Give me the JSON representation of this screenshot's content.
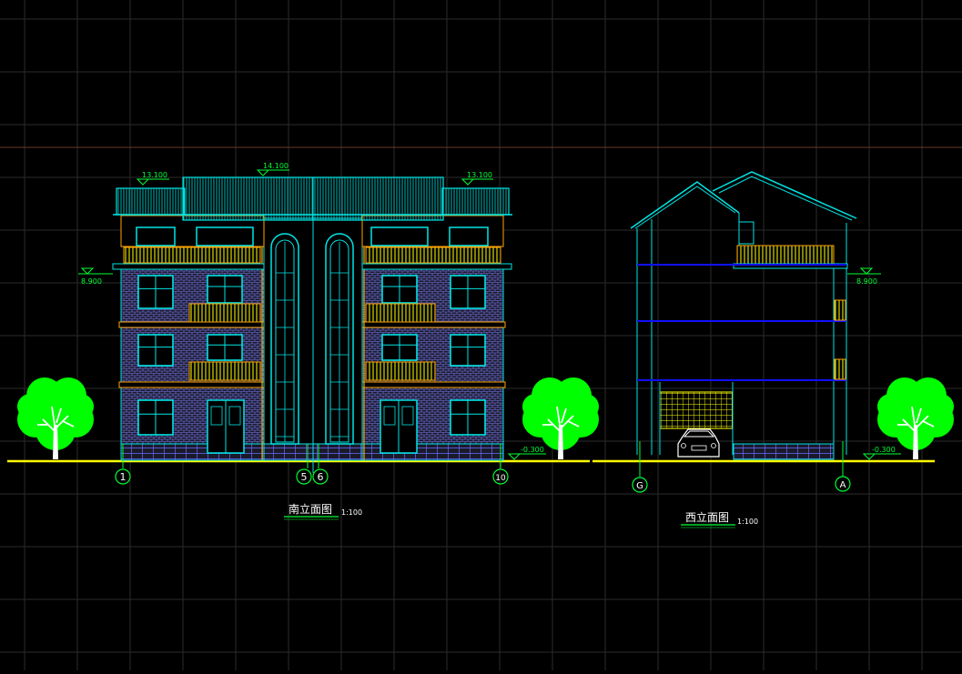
{
  "canvas": {
    "background": "#000000",
    "grid_color": "#2b2b2b",
    "crosshair_color": "#6a3a2a"
  },
  "colors": {
    "outline": "#00e5e5",
    "level": "#00ff33",
    "yellow": "#ffff00",
    "orange": "#ffa500",
    "blue": "#1010ff",
    "white": "#ffffff",
    "tree": "#00ff00",
    "brick": "#8080ff"
  },
  "south": {
    "title": "南立面图",
    "scale": "1:100",
    "levels": {
      "roof_left": "13.100",
      "roof_mid": "14.100",
      "roof_right": "13.100",
      "floor3": "8.900",
      "ground": "-0.300"
    },
    "axes": [
      "1",
      "5",
      "6",
      "10"
    ]
  },
  "west": {
    "title": "西立面图",
    "scale": "1:100",
    "levels": {
      "floor3": "8.900",
      "ground": "-0.300"
    },
    "axes": [
      "G",
      "A"
    ]
  },
  "icons": {
    "tree": "tree-icon",
    "car": "car-icon",
    "level_marker": "level-marker-icon"
  }
}
